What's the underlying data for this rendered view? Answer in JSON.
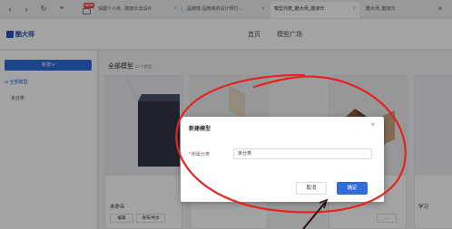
{
  "browser": {
    "tabs": [
      {
        "label": "快图个人库 - 酷家乐云设计"
      },
      {
        "label": "品牌馆 品牌商的设计师打..."
      },
      {
        "label": "模型列表_酷大师_酷家乐"
      },
      {
        "label": "酷大师_酷家乐"
      }
    ],
    "new_badge": "NEW"
  },
  "app": {
    "logo": "酷大师",
    "nav": [
      "首页",
      "模型广场"
    ]
  },
  "sidebar": {
    "new_button": "新建 ▾",
    "all_models": "全部模型",
    "uncategorized": "未分类"
  },
  "main": {
    "title": "全部模型",
    "count": "44个模型",
    "card_name": "未命名",
    "card_edit": "编辑",
    "card_share": "发布/共享",
    "card_tag": "学习"
  },
  "modal": {
    "title": "新建模型",
    "field_label": "所属分类",
    "required_mark": "*",
    "select_value": "未分类",
    "cancel": "取消",
    "ok": "确定"
  },
  "annotation": {
    "color": "#e8221f"
  }
}
